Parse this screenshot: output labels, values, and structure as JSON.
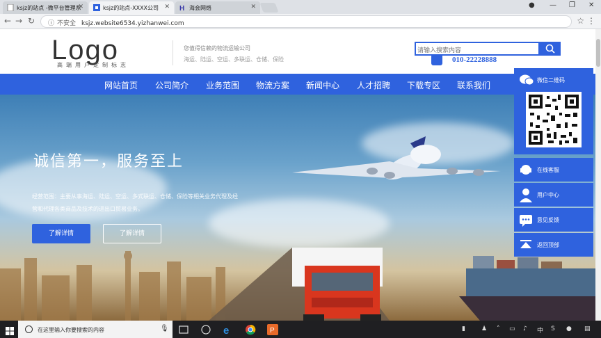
{
  "browser": {
    "tabs": [
      {
        "title": "ksjz的站点 -微平台管理系",
        "active": false,
        "favicon": "page-icon"
      },
      {
        "title": "ksjz的站点-XXXX公司",
        "active": true,
        "favicon": "site-icon"
      },
      {
        "title": "海会网络",
        "active": false,
        "favicon": "h-logo-icon"
      }
    ],
    "security_label": "不安全",
    "url": "ksjz.website6534.yizhanwei.com"
  },
  "header": {
    "logo_text": "Logo",
    "logo_subtitle": "高端用户定制标志",
    "tagline": "您值得信赖的物流运输公司",
    "services": "海运、陆运、空运、多联运、仓储、保险",
    "search_placeholder": "请输入搜索内容",
    "phone": "010-22228888"
  },
  "nav": {
    "items": [
      "网站首页",
      "公司简介",
      "业务范围",
      "物流方案",
      "新闻中心",
      "人才招聘",
      "下载专区",
      "联系我们"
    ]
  },
  "hero": {
    "title": "诚信第一，服务至上",
    "description": "经营范围：主要从事海运、陆运、空运、多式联运、仓储、保险等相关业务代理及经营和代理各类商品及技术的进出口贸易业务。",
    "button_primary": "了解详情",
    "button_secondary": "了解详情"
  },
  "side_panel": {
    "qr_label": "微信二维码",
    "items": [
      {
        "label": "在线客服",
        "icon": "customer-service-icon"
      },
      {
        "label": "用户中心",
        "icon": "user-icon"
      },
      {
        "label": "意见反馈",
        "icon": "feedback-icon"
      },
      {
        "label": "返回顶部",
        "icon": "back-to-top-icon"
      }
    ]
  },
  "taskbar": {
    "search_placeholder": "在这里输入你要搜索的内容"
  },
  "colors": {
    "brand_blue": "#2f62de",
    "taskbar": "#1f1f22"
  }
}
